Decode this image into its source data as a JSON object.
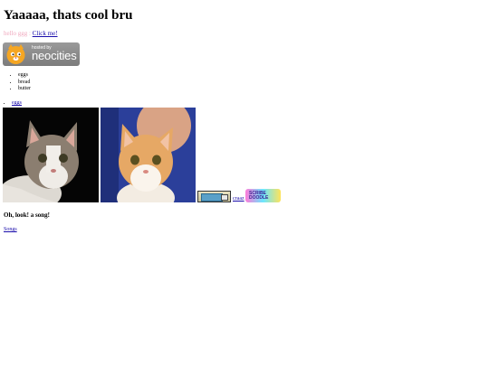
{
  "heading": "Yaaaaa, thats cool bru",
  "intro": {
    "faint_text": "hello ggg  :",
    "link_text": "Click me!"
  },
  "badge": {
    "hosted_by": "hosted by",
    "name": "neocities"
  },
  "list_items": [
    "eggs",
    "bread",
    "butter"
  ],
  "link_list": [
    "eggs"
  ],
  "images": [
    {
      "icon": "cat-photo-tabby-white"
    },
    {
      "icon": "cat-photo-orange-kitten"
    }
  ],
  "craaz_link": "craaz",
  "rainbow_button_text": "SCRIBE DOODLE",
  "song_heading": "Oh, look! a song!",
  "songs_link": "Songs",
  "colors": {
    "link": "#1a0dab",
    "faint": "#f0a9be",
    "badge": "#8c8c8c"
  }
}
